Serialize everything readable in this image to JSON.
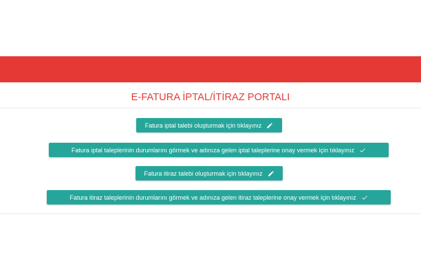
{
  "header": {
    "brand_color": "#e53935"
  },
  "portal": {
    "title": "E-FATURA İPTAL/İTİRAZ PORTALI"
  },
  "actions": [
    {
      "label": "Fatura iptal talebi oluşturmak için tıklayınız",
      "icon": "pencil-icon"
    },
    {
      "label": "Fatura iptal taleplerinin durumlarını görmek ve adınıza gelen iptal taleplerine onay vermek için tıklayınız",
      "icon": "check-icon"
    },
    {
      "label": "Fatura itiraz talebi oluşturmak için tıklayınız",
      "icon": "pencil-icon"
    },
    {
      "label": "Fatura itiraz taleplerinin durumlarını görmek ve adınıza gelen itiraz taleplerine onay vermek için tıklayınız",
      "icon": "check-icon"
    }
  ],
  "colors": {
    "button": "#26a69a",
    "title": "#e53935"
  }
}
